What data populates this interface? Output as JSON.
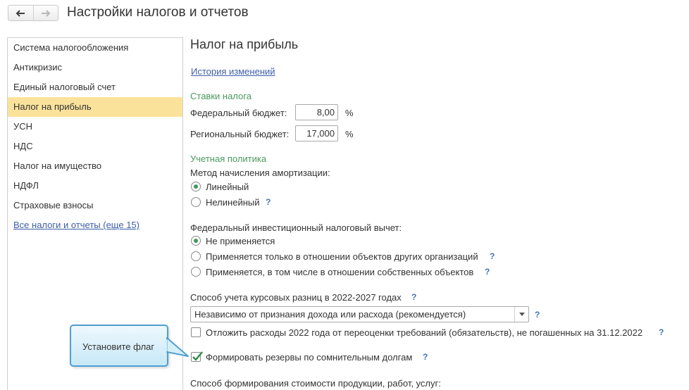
{
  "header": {
    "back_icon": "arrow-left-icon",
    "forward_icon": "arrow-right-icon",
    "title": "Настройки налогов и отчетов"
  },
  "sidebar": {
    "items": [
      {
        "label": "Система налогообложения",
        "active": false
      },
      {
        "label": "Антикризис",
        "active": false
      },
      {
        "label": "Единый налоговый счет",
        "active": false
      },
      {
        "label": "Налог на прибыль",
        "active": true
      },
      {
        "label": "УСН",
        "active": false
      },
      {
        "label": "НДС",
        "active": false
      },
      {
        "label": "Налог на имущество",
        "active": false
      },
      {
        "label": "НДФЛ",
        "active": false
      },
      {
        "label": "Страховые взносы",
        "active": false
      }
    ],
    "all_link": "Все налоги и отчеты (еще 15)"
  },
  "main": {
    "heading": "Налог на прибыль",
    "history_link": "История изменений",
    "rates": {
      "section": "Ставки налога",
      "federal_label": "Федеральный бюджет:",
      "federal_value": "8,00",
      "regional_label": "Региональный бюджет:",
      "regional_value": "17,000",
      "percent": "%"
    },
    "policy": {
      "section": "Учетная политика",
      "amort_label": "Метод начисления амортизации:",
      "amort_options": [
        {
          "label": "Линейный",
          "selected": true,
          "help": false
        },
        {
          "label": "Нелинейный",
          "selected": false,
          "help": true
        }
      ],
      "invest_label": "Федеральный инвестиционный налоговый вычет:",
      "invest_options": [
        {
          "label": "Не применяется",
          "selected": true,
          "help": false
        },
        {
          "label": "Применяется только в отношении объектов других организаций",
          "selected": false,
          "help": true
        },
        {
          "label": "Применяется, в том числе в отношении собственных объектов",
          "selected": false,
          "help": true
        }
      ],
      "fx_label": "Способ учета курсовых разниц в 2022-2027 годах",
      "fx_value": "Независимо от признания дохода или расхода (рекомендуется)",
      "defer_label": "Отложить расходы 2022 года от переоценки требований (обязательств), не погашенных на 31.12.2022",
      "defer_checked": false,
      "reserve_label": "Формировать резервы по сомнительным долгам",
      "reserve_checked": true,
      "cost_label": "Способ формирования стоимости продукции, работ, услуг:"
    },
    "help_mark": "?"
  },
  "callout": {
    "text": "Установите флаг"
  }
}
